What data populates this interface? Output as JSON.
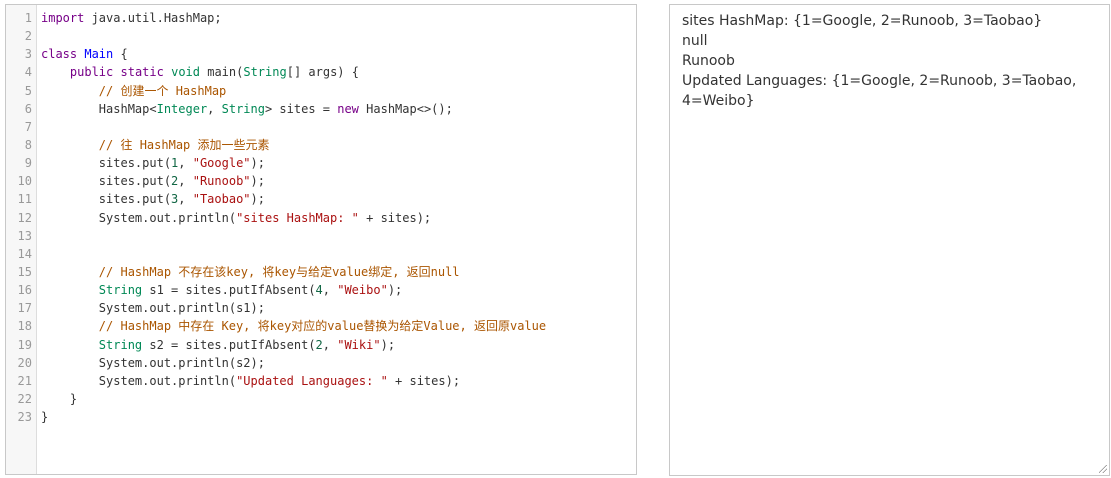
{
  "editor": {
    "lines": [
      {
        "n": "1",
        "tokens": [
          {
            "t": "kw",
            "s": "import"
          },
          {
            "t": "plain",
            "s": " java.util.HashMap;"
          }
        ]
      },
      {
        "n": "2",
        "tokens": []
      },
      {
        "n": "3",
        "tokens": [
          {
            "t": "kw",
            "s": "class"
          },
          {
            "t": "plain",
            "s": " "
          },
          {
            "t": "def",
            "s": "Main"
          },
          {
            "t": "plain",
            "s": " {"
          }
        ]
      },
      {
        "n": "4",
        "tokens": [
          {
            "t": "plain",
            "s": "    "
          },
          {
            "t": "kw",
            "s": "public"
          },
          {
            "t": "plain",
            "s": " "
          },
          {
            "t": "kw",
            "s": "static"
          },
          {
            "t": "plain",
            "s": " "
          },
          {
            "t": "type",
            "s": "void"
          },
          {
            "t": "plain",
            "s": " main("
          },
          {
            "t": "type",
            "s": "String"
          },
          {
            "t": "plain",
            "s": "[] args) {"
          }
        ]
      },
      {
        "n": "5",
        "tokens": [
          {
            "t": "plain",
            "s": "        "
          },
          {
            "t": "com",
            "s": "// 创建一个 HashMap"
          }
        ]
      },
      {
        "n": "6",
        "tokens": [
          {
            "t": "plain",
            "s": "        HashMap<"
          },
          {
            "t": "type",
            "s": "Integer"
          },
          {
            "t": "plain",
            "s": ", "
          },
          {
            "t": "type",
            "s": "String"
          },
          {
            "t": "plain",
            "s": "> sites = "
          },
          {
            "t": "kw",
            "s": "new"
          },
          {
            "t": "plain",
            "s": " HashMap<>();"
          }
        ]
      },
      {
        "n": "7",
        "tokens": []
      },
      {
        "n": "8",
        "tokens": [
          {
            "t": "plain",
            "s": "        "
          },
          {
            "t": "com",
            "s": "// 往 HashMap 添加一些元素"
          }
        ]
      },
      {
        "n": "9",
        "tokens": [
          {
            "t": "plain",
            "s": "        sites.put("
          },
          {
            "t": "num",
            "s": "1"
          },
          {
            "t": "plain",
            "s": ", "
          },
          {
            "t": "str",
            "s": "\"Google\""
          },
          {
            "t": "plain",
            "s": ");"
          }
        ]
      },
      {
        "n": "10",
        "tokens": [
          {
            "t": "plain",
            "s": "        sites.put("
          },
          {
            "t": "num",
            "s": "2"
          },
          {
            "t": "plain",
            "s": ", "
          },
          {
            "t": "str",
            "s": "\"Runoob\""
          },
          {
            "t": "plain",
            "s": ");"
          }
        ]
      },
      {
        "n": "11",
        "tokens": [
          {
            "t": "plain",
            "s": "        sites.put("
          },
          {
            "t": "num",
            "s": "3"
          },
          {
            "t": "plain",
            "s": ", "
          },
          {
            "t": "str",
            "s": "\"Taobao\""
          },
          {
            "t": "plain",
            "s": ");"
          }
        ]
      },
      {
        "n": "12",
        "tokens": [
          {
            "t": "plain",
            "s": "        System.out.println("
          },
          {
            "t": "str",
            "s": "\"sites HashMap: \""
          },
          {
            "t": "plain",
            "s": " + sites);"
          }
        ]
      },
      {
        "n": "13",
        "tokens": []
      },
      {
        "n": "14",
        "tokens": []
      },
      {
        "n": "15",
        "tokens": [
          {
            "t": "plain",
            "s": "        "
          },
          {
            "t": "com",
            "s": "// HashMap 不存在该key, 将key与给定value绑定, 返回null"
          }
        ]
      },
      {
        "n": "16",
        "tokens": [
          {
            "t": "plain",
            "s": "        "
          },
          {
            "t": "type",
            "s": "String"
          },
          {
            "t": "plain",
            "s": " s1 = sites.putIfAbsent("
          },
          {
            "t": "num",
            "s": "4"
          },
          {
            "t": "plain",
            "s": ", "
          },
          {
            "t": "str",
            "s": "\"Weibo\""
          },
          {
            "t": "plain",
            "s": ");"
          }
        ]
      },
      {
        "n": "17",
        "tokens": [
          {
            "t": "plain",
            "s": "        System.out.println(s1);"
          }
        ]
      },
      {
        "n": "18",
        "tokens": [
          {
            "t": "plain",
            "s": "        "
          },
          {
            "t": "com",
            "s": "// HashMap 中存在 Key, 将key对应的value替换为给定Value, 返回原value"
          }
        ]
      },
      {
        "n": "19",
        "tokens": [
          {
            "t": "plain",
            "s": "        "
          },
          {
            "t": "type",
            "s": "String"
          },
          {
            "t": "plain",
            "s": " s2 = sites.putIfAbsent("
          },
          {
            "t": "num",
            "s": "2"
          },
          {
            "t": "plain",
            "s": ", "
          },
          {
            "t": "str",
            "s": "\"Wiki\""
          },
          {
            "t": "plain",
            "s": ");"
          }
        ]
      },
      {
        "n": "20",
        "tokens": [
          {
            "t": "plain",
            "s": "        System.out.println(s2);"
          }
        ]
      },
      {
        "n": "21",
        "tokens": [
          {
            "t": "plain",
            "s": "        System.out.println("
          },
          {
            "t": "str",
            "s": "\"Updated Languages: \""
          },
          {
            "t": "plain",
            "s": " + sites);"
          }
        ]
      },
      {
        "n": "22",
        "tokens": [
          {
            "t": "plain",
            "s": "    }"
          }
        ]
      },
      {
        "n": "23",
        "tokens": [
          {
            "t": "plain",
            "s": "}"
          }
        ]
      }
    ]
  },
  "output": {
    "lines": [
      "sites HashMap: {1=Google, 2=Runoob, 3=Taobao}",
      "null",
      "Runoob",
      "Updated Languages: {1=Google, 2=Runoob, 3=Taobao,\n4=Weibo}"
    ]
  },
  "colors": {
    "keyword": "#770088",
    "type": "#008855",
    "definition": "#0000ff",
    "string": "#aa1111",
    "number": "#116644",
    "comment": "#aa5500"
  }
}
